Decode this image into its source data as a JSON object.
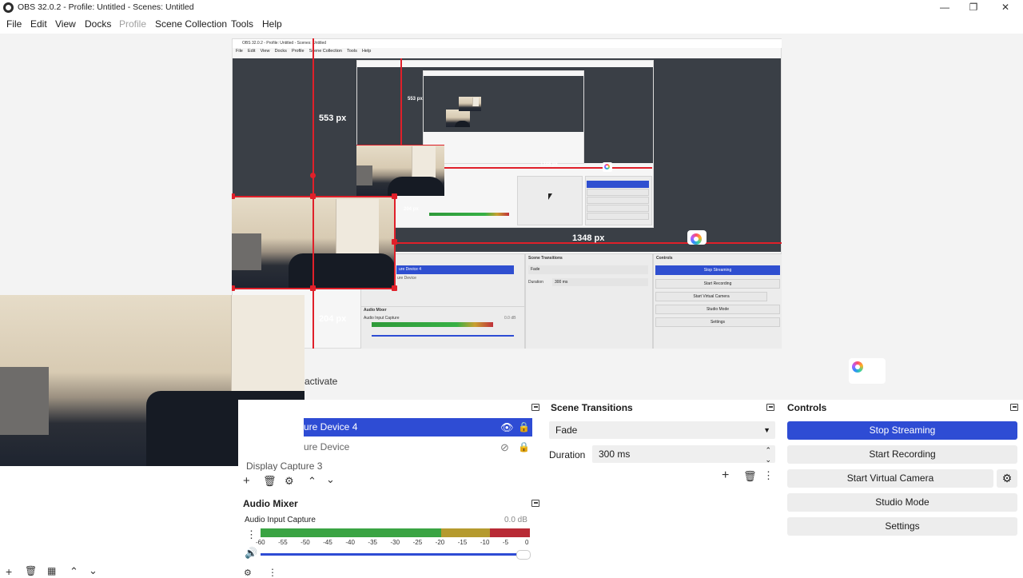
{
  "window": {
    "title": "OBS 32.0.2 - Profile: Untitled - Scenes: Untitled",
    "minimize_icon": "minimize-icon",
    "maximize_icon": "restore-icon",
    "close_icon": "close-icon"
  },
  "menu": {
    "file": "File",
    "edit": "Edit",
    "view": "View",
    "docks": "Docks",
    "profile": "Profile",
    "scene_collection": "Scene Collection",
    "tools": "Tools",
    "help": "Help"
  },
  "preview": {
    "height_label": "553 px",
    "width_label": "1348 px",
    "source_height_label": "204 px",
    "nested": {
      "menu": [
        "File",
        "Edit",
        "View",
        "Docks",
        "Profile",
        "Scene Collection",
        "Tools",
        "Help"
      ],
      "scene_transitions_title": "Scene Transitions",
      "controls_title": "Controls",
      "transition_value": "Fade",
      "duration_label": "Duration",
      "duration_value": "300 ms",
      "stop_streaming": "Stop Streaming",
      "start_recording": "Start Recording",
      "start_virtual_camera": "Start Virtual Camera",
      "studio_mode": "Studio Mode",
      "settings": "Settings",
      "audio_mixer": "Audio Mixer",
      "audio_input_capture": "Audio Input Capture",
      "audio_level": "0.0 dB",
      "source_row_selected": "ure Device 4",
      "source_row_2": "ure Device",
      "inner_height_label": "553 px",
      "inner_width_label": "1348 px",
      "inner_source_label": "204 px"
    }
  },
  "activate_text": "activate",
  "sources": {
    "rows": [
      {
        "label": "ure Device 4",
        "selected": true
      },
      {
        "label": "ure Device",
        "selected": false
      },
      {
        "label": "Display Capture 3",
        "selected": false
      }
    ]
  },
  "scene_transitions": {
    "title": "Scene Transitions",
    "transition": "Fade",
    "duration_label": "Duration",
    "duration_value": "300 ms"
  },
  "controls": {
    "title": "Controls",
    "stop_streaming": "Stop Streaming",
    "start_recording": "Start Recording",
    "start_virtual_camera": "Start Virtual Camera",
    "studio_mode": "Studio Mode",
    "settings": "Settings"
  },
  "audio_mixer": {
    "title": "Audio Mixer",
    "channel": "Audio Input Capture",
    "level": "0.0 dB",
    "ticks": [
      "-60",
      "-55",
      "-50",
      "-45",
      "-40",
      "-35",
      "-30",
      "-25",
      "-20",
      "-15",
      "-10",
      "-5",
      "0"
    ],
    "volume_fraction": 1.0
  },
  "colors": {
    "accent": "#2e4cd4",
    "guide_red": "#e0202a",
    "meter_green": "#2f9a3a",
    "meter_yellow": "#c8a030",
    "meter_red": "#c0303a"
  }
}
